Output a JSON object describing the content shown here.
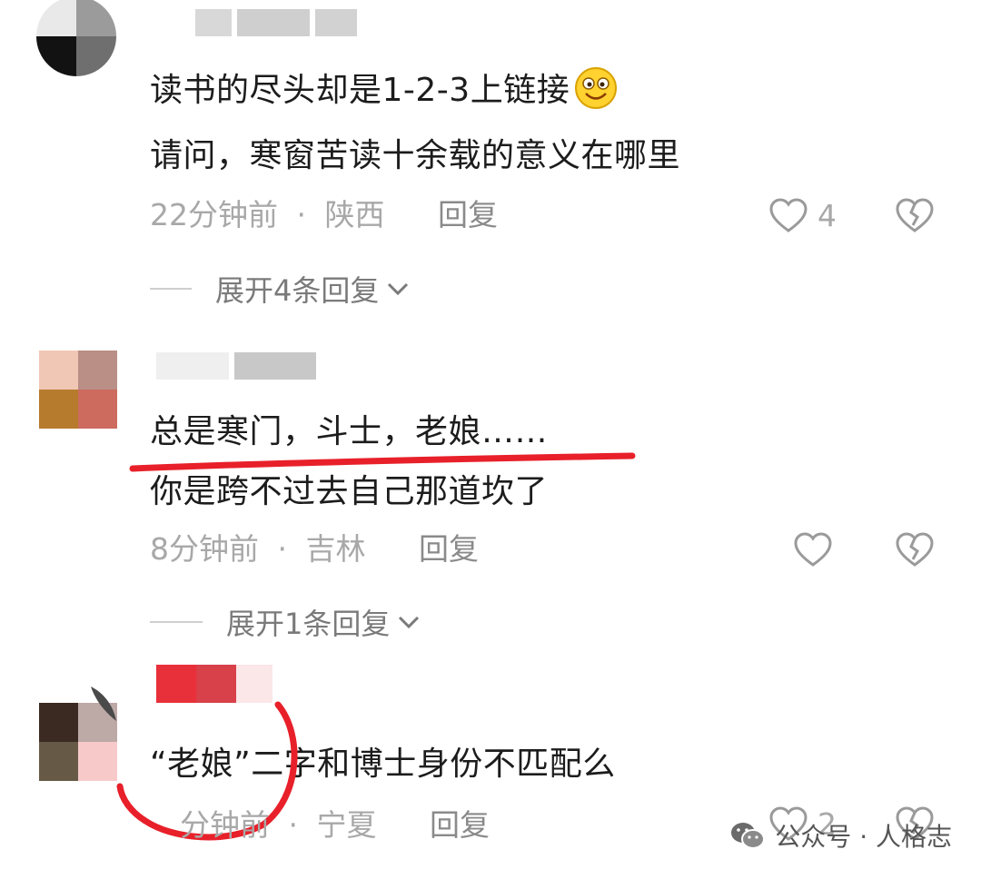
{
  "comments": [
    {
      "lines": [
        "读书的尽头却是1-2-3上链接",
        "请问，寒窗苦读十余载的意义在哪里"
      ],
      "time": "22分钟前",
      "location": "陕西",
      "reply_label": "回复",
      "like_count": "4",
      "expand_label": "展开4条回复"
    },
    {
      "lines": [
        "总是寒门，斗士，老娘……",
        "你是跨不过去自己那道坎了"
      ],
      "time": "8分钟前",
      "location": "吉林",
      "reply_label": "回复",
      "like_count": "",
      "expand_label": "展开1条回复"
    },
    {
      "lines": [
        "“老娘”二字和博士身份不匹配么"
      ],
      "time": "分钟前",
      "location": "宁夏",
      "reply_label": "回复",
      "like_count": "2"
    }
  ],
  "separator": "·",
  "watermark": "公众号 · 人格志",
  "annotation_color": "#e8202a",
  "icons": [
    "smile-emoji-icon",
    "heart-icon",
    "broken-heart-icon",
    "chevron-down-icon",
    "wechat-icon"
  ]
}
